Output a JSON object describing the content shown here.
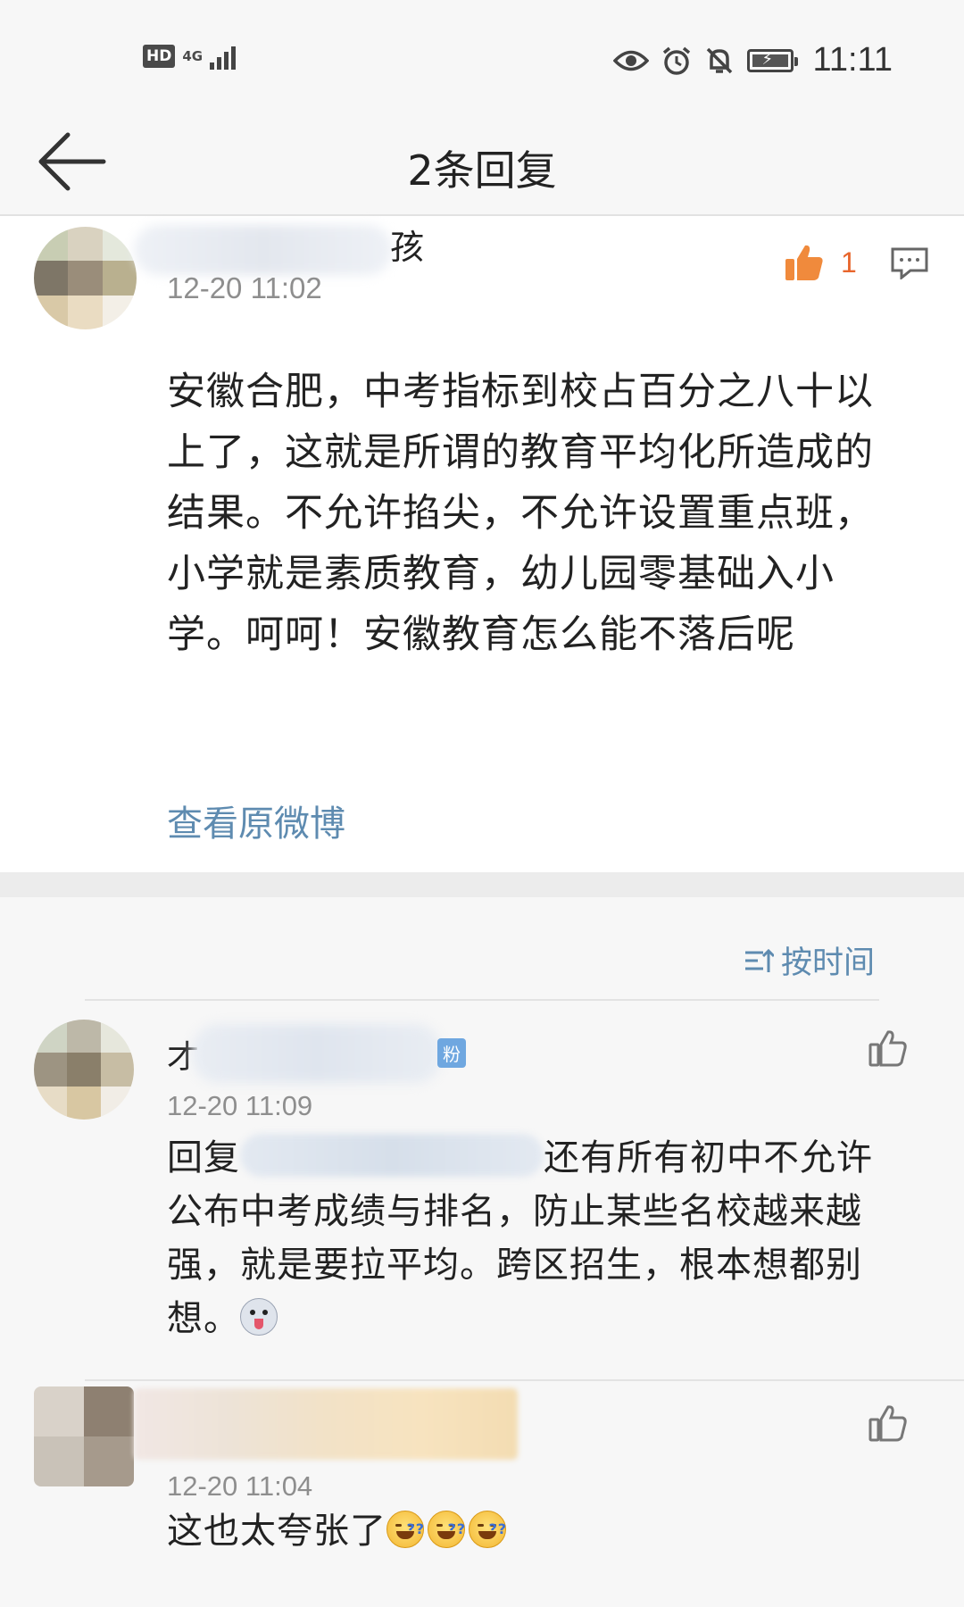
{
  "status_bar": {
    "hd": "HD",
    "network": "4G",
    "time": "11:11",
    "icons": [
      "eye-icon",
      "alarm-icon",
      "bell-off-icon",
      "battery-icon"
    ]
  },
  "nav": {
    "back_icon": "back-arrow-icon",
    "title": "2条回复"
  },
  "main_comment": {
    "username_visible": "孩",
    "timestamp": "12-20 11:02",
    "like_count": "1",
    "body": "安徽合肥，中考指标到校占百分之八十以上了，这就是所谓的教育平均化所造成的结果。不允许掐尖，不允许设置重点班，小学就是素质教育，幼儿园零基础入小学。呵呵！安徽教育怎么能不落后呢",
    "view_original": "查看原微博"
  },
  "sort": {
    "label": "按时间",
    "icon": "sort-icon"
  },
  "replies": [
    {
      "username_visible": "才",
      "badge": "粉",
      "timestamp": "12-20 11:09",
      "body_prefix": "回复",
      "body": "还有所有初中不允许公布中考成绩与排名，防止某些名校越来越强，就是要拉平均。跨区招生，根本想都别想。",
      "emoji": "husky-emoji"
    },
    {
      "timestamp": "12-20 11:04",
      "body": "这也太夸张了",
      "emoji": "laugh-sweat-emoji",
      "emoji_count": 3
    }
  ]
}
